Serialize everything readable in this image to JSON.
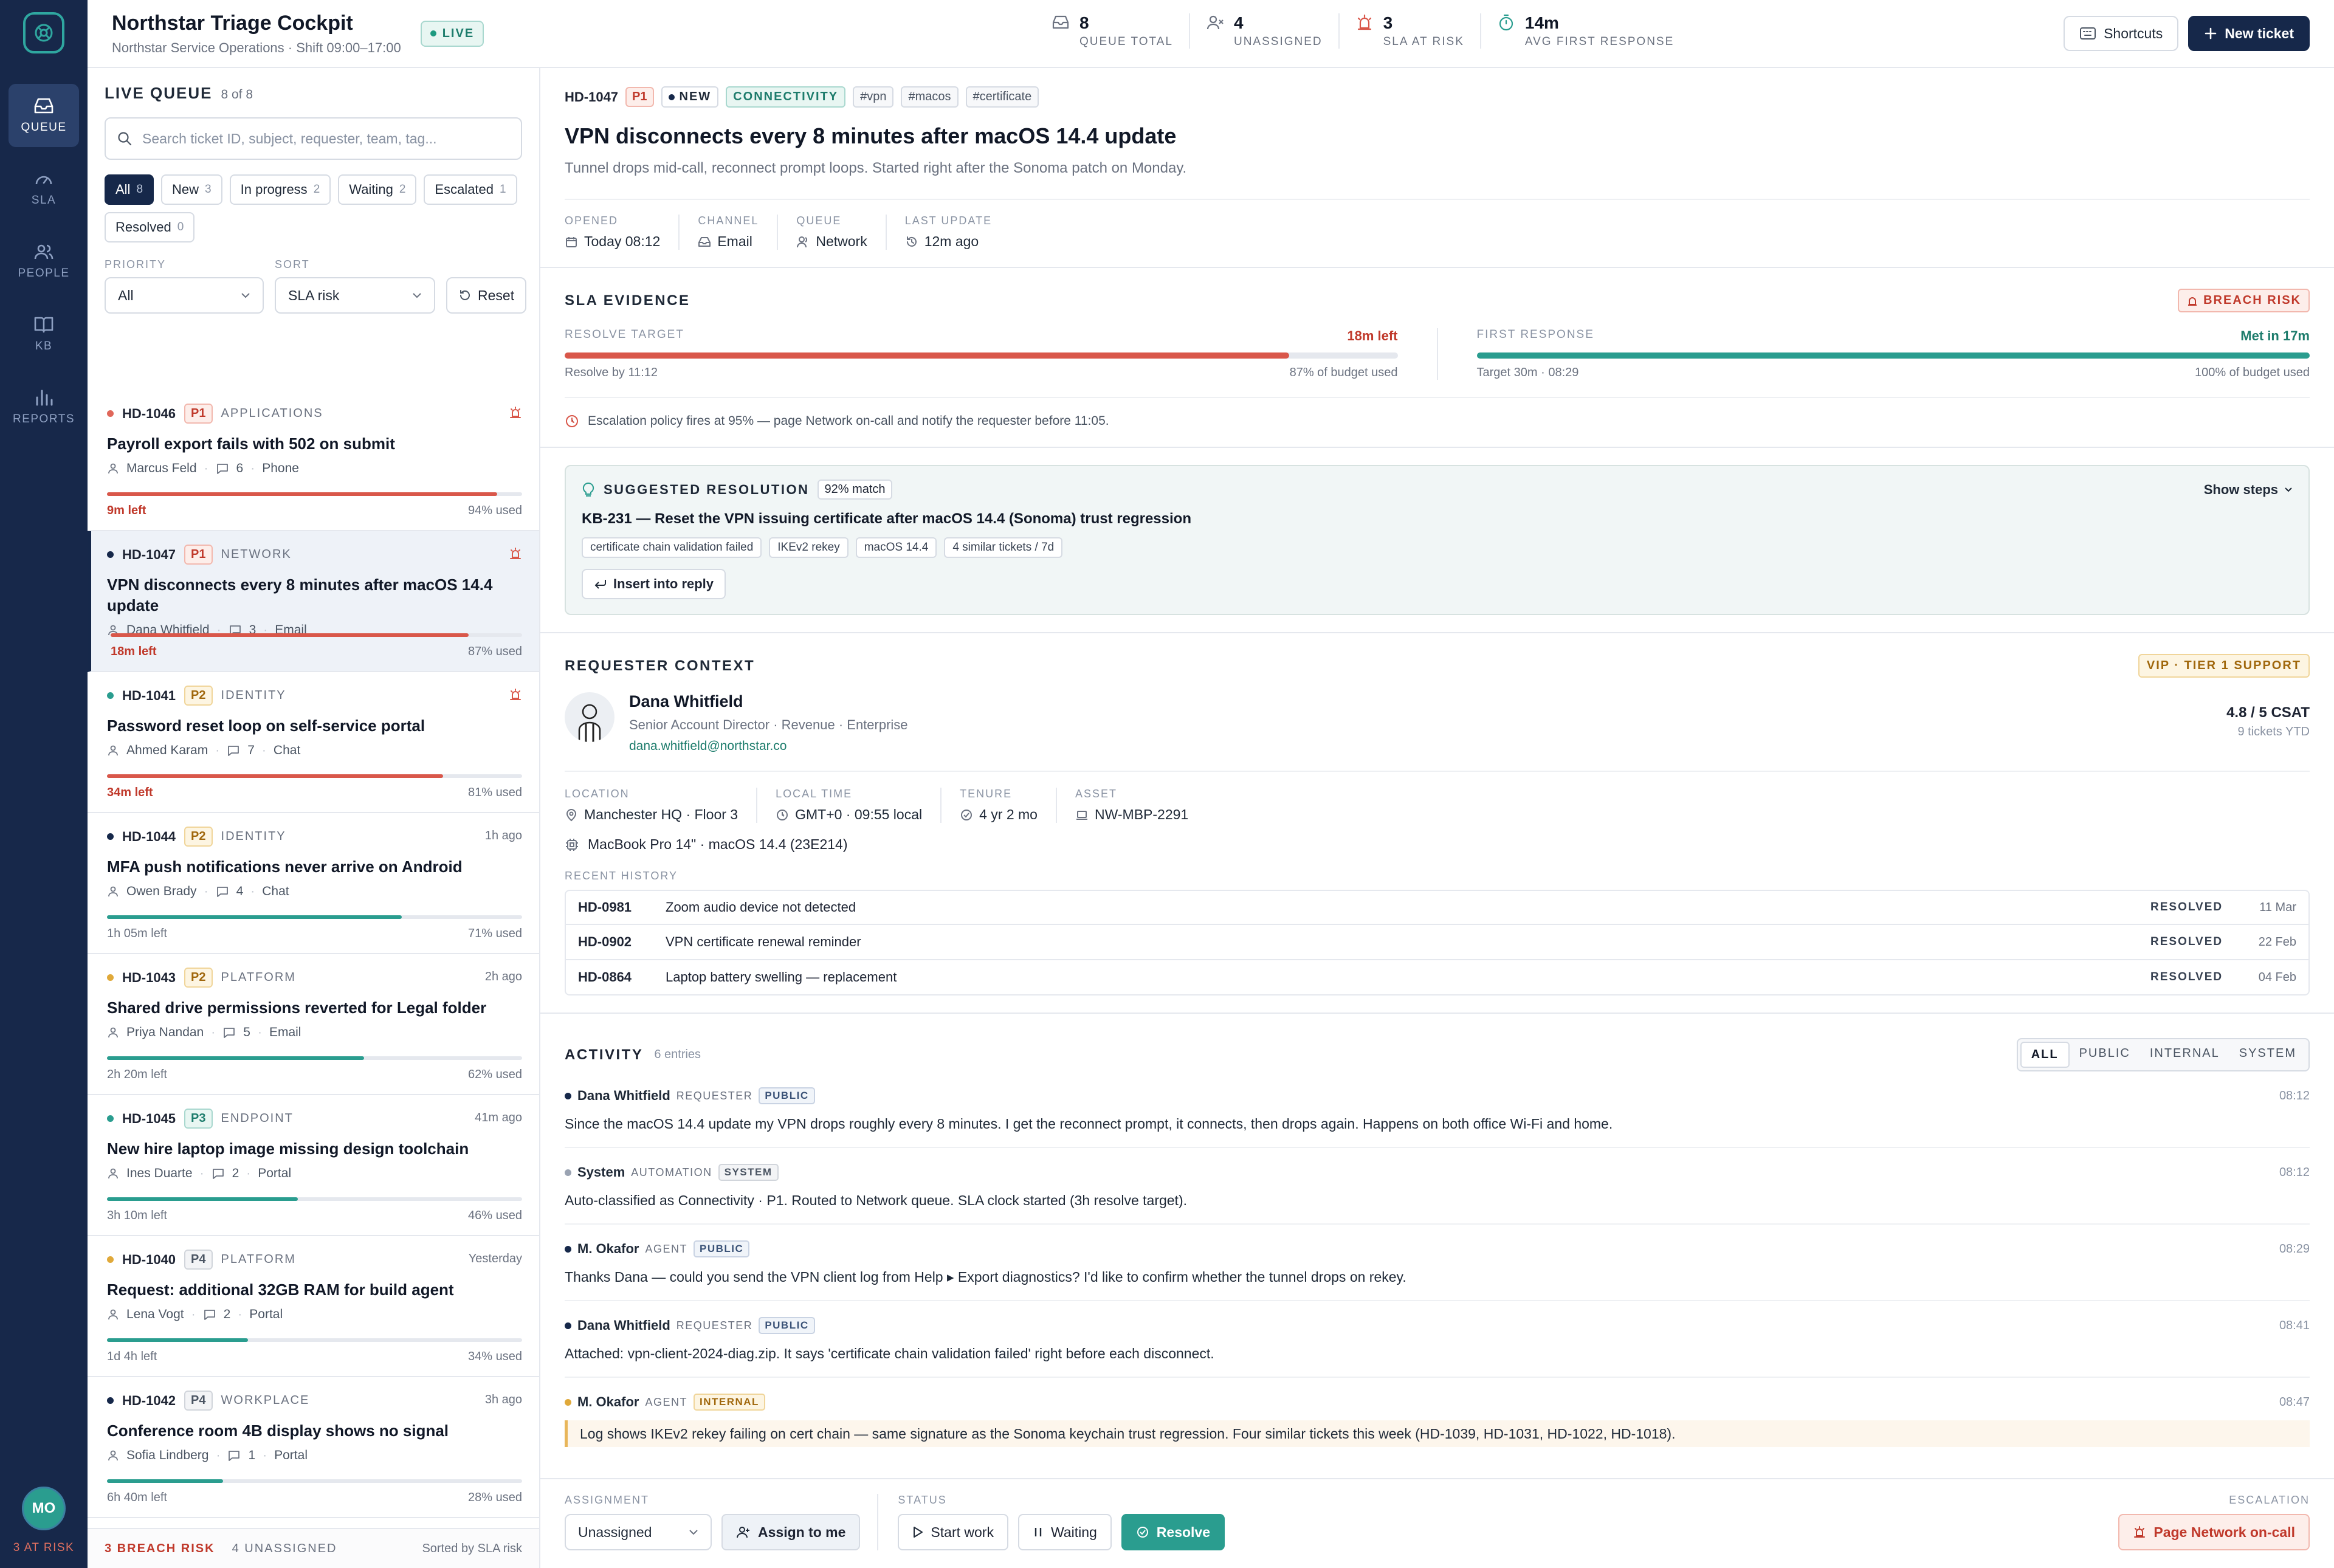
{
  "app": {
    "title": "Northstar Triage Cockpit",
    "subtitle": "Northstar Service Operations · Shift 09:00–17:00",
    "live": "LIVE"
  },
  "rail": {
    "items": [
      {
        "label": "QUEUE"
      },
      {
        "label": "SLA"
      },
      {
        "label": "PEOPLE"
      },
      {
        "label": "KB"
      },
      {
        "label": "REPORTS"
      }
    ],
    "user_initials": "MO",
    "user_risk": "3 AT RISK"
  },
  "stats": [
    {
      "value": "8",
      "label": "QUEUE TOTAL",
      "icon": "inbox-icon"
    },
    {
      "value": "4",
      "label": "UNASSIGNED",
      "icon": "user-x-icon"
    },
    {
      "value": "3",
      "label": "SLA AT RISK",
      "icon": "alarm-icon"
    },
    {
      "value": "14m",
      "label": "AVG FIRST RESPONSE",
      "icon": "timer-icon"
    }
  ],
  "toolbar": {
    "shortcuts": "Shortcuts",
    "new_ticket": "New ticket"
  },
  "queue": {
    "title": "LIVE QUEUE",
    "count": "8 of 8",
    "search_placeholder": "Search ticket ID, subject, requester, team, tag...",
    "chips": [
      {
        "label": "All",
        "count": "8"
      },
      {
        "label": "New",
        "count": "3"
      },
      {
        "label": "In progress",
        "count": "2"
      },
      {
        "label": "Waiting",
        "count": "2"
      },
      {
        "label": "Escalated",
        "count": "1"
      },
      {
        "label": "Resolved",
        "count": "0"
      }
    ],
    "priority_label": "PRIORITY",
    "priority_value": "All",
    "sort_label": "SORT",
    "sort_value": "SLA risk",
    "reset": "Reset",
    "tickets": [
      {
        "id": "HD-1046",
        "pri": "P1",
        "team": "APPLICATIONS",
        "right": "",
        "subject": "Payroll export fails with 502 on submit",
        "requester": "Marcus Feld",
        "comments": "6",
        "channel": "Phone",
        "left": "9m left",
        "used": "94% used",
        "pct": 94,
        "dot": "#e0675a",
        "bar": "#d9574a",
        "alarm": true
      },
      {
        "id": "HD-1047",
        "pri": "P1",
        "team": "NETWORK",
        "right": "",
        "subject": "VPN disconnects every 8 minutes after macOS 14.4 update",
        "requester": "Dana Whitfield",
        "comments": "3",
        "channel": "Email",
        "left": "18m left",
        "used": "87% used",
        "pct": 87,
        "dot": "#16284a",
        "bar": "#d9574a",
        "alarm": true
      },
      {
        "id": "HD-1041",
        "pri": "P2",
        "team": "IDENTITY",
        "right": "",
        "subject": "Password reset loop on self-service portal",
        "requester": "Ahmed Karam",
        "comments": "7",
        "channel": "Chat",
        "left": "34m left",
        "used": "81% used",
        "pct": 81,
        "dot": "#2a9d8f",
        "bar": "#d9574a",
        "alarm": true
      },
      {
        "id": "HD-1044",
        "pri": "P2",
        "team": "IDENTITY",
        "right": "1h ago",
        "subject": "MFA push notifications never arrive on Android",
        "requester": "Owen Brady",
        "comments": "4",
        "channel": "Chat",
        "left": "1h 05m left",
        "used": "71% used",
        "pct": 71,
        "dot": "#16284a",
        "bar": "#2a9d8f",
        "alarm": false
      },
      {
        "id": "HD-1043",
        "pri": "P2",
        "team": "PLATFORM",
        "right": "2h ago",
        "subject": "Shared drive permissions reverted for Legal folder",
        "requester": "Priya Nandan",
        "comments": "5",
        "channel": "Email",
        "left": "2h 20m left",
        "used": "62% used",
        "pct": 62,
        "dot": "#e0a93a",
        "bar": "#2a9d8f",
        "alarm": false
      },
      {
        "id": "HD-1045",
        "pri": "P3",
        "team": "ENDPOINT",
        "right": "41m ago",
        "subject": "New hire laptop image missing design toolchain",
        "requester": "Ines Duarte",
        "comments": "2",
        "channel": "Portal",
        "left": "3h 10m left",
        "used": "46% used",
        "pct": 46,
        "dot": "#2a9d8f",
        "bar": "#2a9d8f",
        "alarm": false
      },
      {
        "id": "HD-1040",
        "pri": "P4",
        "team": "PLATFORM",
        "right": "Yesterday",
        "subject": "Request: additional 32GB RAM for build agent",
        "requester": "Lena Vogt",
        "comments": "2",
        "channel": "Portal",
        "left": "1d 4h left",
        "used": "34% used",
        "pct": 34,
        "dot": "#e0a93a",
        "bar": "#2a9d8f",
        "alarm": false
      },
      {
        "id": "HD-1042",
        "pri": "P4",
        "team": "WORKPLACE",
        "right": "3h ago",
        "subject": "Conference room 4B display shows no signal",
        "requester": "Sofia Lindberg",
        "comments": "1",
        "channel": "Portal",
        "left": "6h 40m left",
        "used": "28% used",
        "pct": 28,
        "dot": "#16284a",
        "bar": "#2a9d8f",
        "alarm": false
      }
    ],
    "footer": {
      "breach": "3 BREACH RISK",
      "unassigned": "4 UNASSIGNED",
      "sorted": "Sorted by SLA risk"
    }
  },
  "ticket": {
    "id": "HD-1047",
    "priority": "P1",
    "status": "NEW",
    "category": "CONNECTIVITY",
    "tags": [
      "#vpn",
      "#macos",
      "#certificate"
    ],
    "title": "VPN disconnects every 8 minutes after macOS 14.4 update",
    "summary": "Tunnel drops mid-call, reconnect prompt loops. Started right after the Sonoma patch on Monday.",
    "meta": [
      {
        "label": "OPENED",
        "value": "Today 08:12"
      },
      {
        "label": "CHANNEL",
        "value": "Email"
      },
      {
        "label": "QUEUE",
        "value": "Network"
      },
      {
        "label": "LAST UPDATE",
        "value": "12m ago"
      }
    ]
  },
  "sla": {
    "title": "SLA EVIDENCE",
    "badge": "BREACH RISK",
    "resolve": {
      "label": "RESOLVE TARGET",
      "status": "18m left",
      "pct": 87,
      "sub": "Resolve by 11:12",
      "used": "87% of budget used"
    },
    "first": {
      "label": "FIRST RESPONSE",
      "status": "Met in 17m",
      "pct": 100,
      "sub": "Target 30m · 08:29",
      "used": "100% of budget used"
    },
    "escalation": "Escalation policy fires at 95% — page Network on-call and notify the requester before 11:05."
  },
  "suggestion": {
    "title": "SUGGESTED RESOLUTION",
    "match": "92% match",
    "show_steps": "Show steps",
    "kb": "KB-231 — Reset the VPN issuing certificate after macOS 14.4 (Sonoma) trust regression",
    "tags": [
      "certificate chain validation failed",
      "IKEv2 rekey",
      "macOS 14.4",
      "4 similar tickets / 7d"
    ],
    "insert": "Insert into reply"
  },
  "requester": {
    "title": "REQUESTER CONTEXT",
    "badge": "VIP · TIER 1 SUPPORT",
    "name": "Dana Whitfield",
    "role": "Senior Account Director · Revenue · Enterprise",
    "email": "dana.whitfield@northstar.co",
    "score": "4.8 / 5 CSAT",
    "score_sub": "9 tickets YTD",
    "meta": [
      {
        "label": "LOCATION",
        "value": "Manchester HQ · Floor 3"
      },
      {
        "label": "LOCAL TIME",
        "value": "GMT+0 · 09:55 local"
      },
      {
        "label": "TENURE",
        "value": "4 yr 2 mo"
      },
      {
        "label": "ASSET",
        "value": "NW-MBP-2291"
      }
    ],
    "device": "MacBook Pro 14\" · macOS 14.4 (23E214)",
    "history_label": "RECENT HISTORY",
    "history": [
      {
        "id": "HD-0981",
        "subject": "Zoom audio device not detected",
        "status": "RESOLVED",
        "date": "11 Mar"
      },
      {
        "id": "HD-0902",
        "subject": "VPN certificate renewal reminder",
        "status": "RESOLVED",
        "date": "22 Feb"
      },
      {
        "id": "HD-0864",
        "subject": "Laptop battery swelling — replacement",
        "status": "RESOLVED",
        "date": "04 Feb"
      }
    ]
  },
  "activity": {
    "title": "ACTIVITY",
    "count": "6 entries",
    "filters": [
      "ALL",
      "PUBLIC",
      "INTERNAL",
      "SYSTEM"
    ],
    "entries": [
      {
        "author": "Dana Whitfield",
        "role": "REQUESTER",
        "vis": "PUBLIC",
        "time": "08:12",
        "text": "Since the macOS 14.4 update my VPN drops roughly every 8 minutes. I get the reconnect prompt, it connects, then drops again. Happens on both office Wi-Fi and home.",
        "dot": "#16284a"
      },
      {
        "author": "System",
        "role": "AUTOMATION",
        "vis": "SYSTEM",
        "time": "08:12",
        "text": "Auto-classified as Connectivity · P1. Routed to Network queue. SLA clock started (3h resolve target).",
        "dot": "#9aa3b2"
      },
      {
        "author": "M. Okafor",
        "role": "AGENT",
        "vis": "PUBLIC",
        "time": "08:29",
        "text": "Thanks Dana — could you send the VPN client log from Help ▸ Export diagnostics? I'd like to confirm whether the tunnel drops on rekey.",
        "dot": "#16284a"
      },
      {
        "author": "Dana Whitfield",
        "role": "REQUESTER",
        "vis": "PUBLIC",
        "time": "08:41",
        "text": "Attached: vpn-client-2024-diag.zip. It says 'certificate chain validation failed' right before each disconnect.",
        "dot": "#16284a"
      },
      {
        "author": "M. Okafor",
        "role": "AGENT",
        "vis": "INTERNAL",
        "time": "08:47",
        "text": "Log shows IKEv2 rekey failing on cert chain — same signature as the Sonoma keychain trust regression. Four similar tickets this week (HD-1039, HD-1031, HD-1022, HD-1018).",
        "dot": "#e0a93a"
      }
    ]
  },
  "actions": {
    "assignment_label": "ASSIGNMENT",
    "assignment_value": "Unassigned",
    "assign_me": "Assign to me",
    "status_label": "STATUS",
    "start": "Start work",
    "waiting": "Waiting",
    "resolve": "Resolve",
    "escalation_label": "ESCALATION",
    "page": "Page Network on-call"
  }
}
